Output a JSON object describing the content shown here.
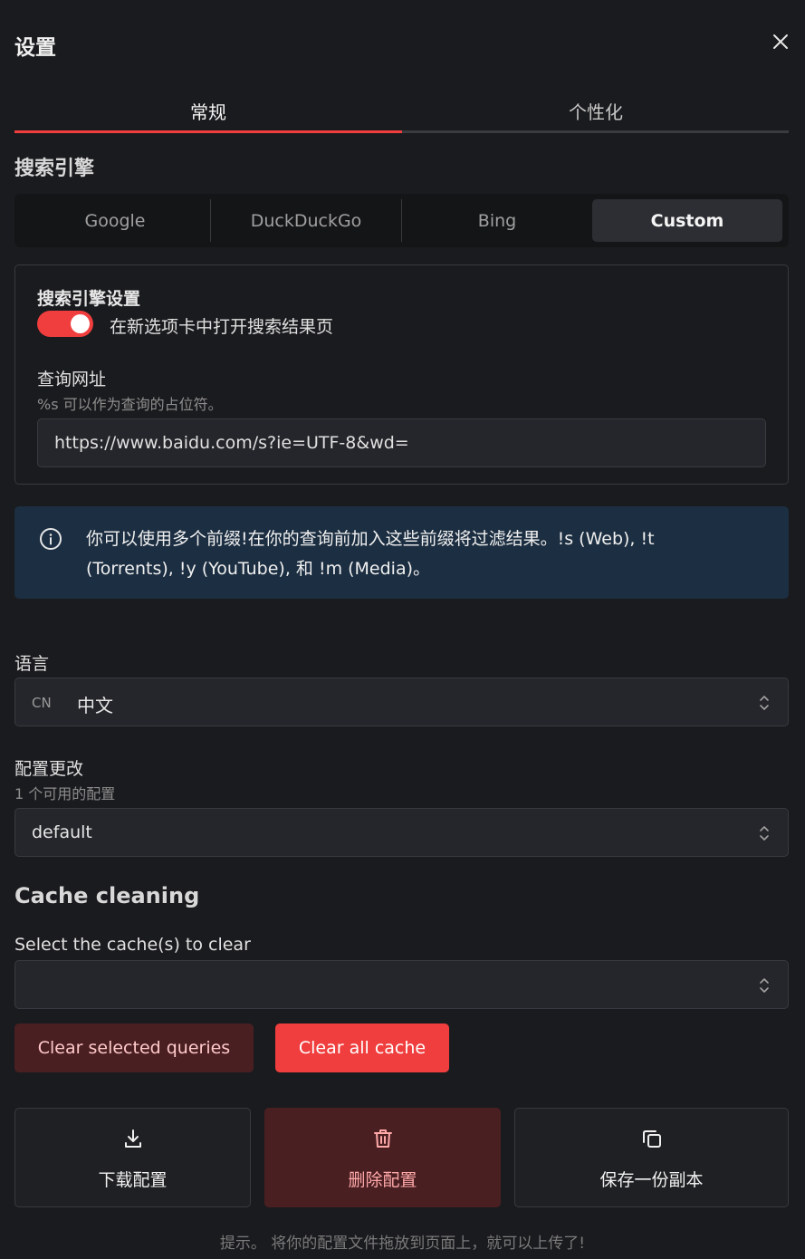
{
  "header": {
    "title": "设置",
    "close_icon": "close-icon"
  },
  "tabs": [
    {
      "label": "常规",
      "active": true
    },
    {
      "label": "个性化",
      "active": false
    }
  ],
  "search_engine": {
    "section_title": "搜索引擎",
    "options": [
      "Google",
      "DuckDuckGo",
      "Bing",
      "Custom"
    ],
    "selected": "Custom"
  },
  "engine_settings": {
    "title": "搜索引擎设置",
    "toggle_label": "在新选项卡中打开搜索结果页",
    "toggle_on": true,
    "query_url_label": "查询网址",
    "query_url_desc": "%s 可以作为查询的占位符。",
    "query_url_value": "https://www.baidu.com/s?ie=UTF-8&wd="
  },
  "info_alert": {
    "icon": "info-icon",
    "text": "你可以使用多个前缀!在你的查询前加入这些前缀将过滤结果。!s (Web), !t (Torrents), !y (YouTube), 和 !m (Media)。"
  },
  "language": {
    "label": "语言",
    "code": "CN",
    "value": "中文"
  },
  "config": {
    "label": "配置更改",
    "desc": "1 个可用的配置",
    "value": "default"
  },
  "cache": {
    "section_title": "Cache cleaning",
    "select_label": "Select the cache(s) to clear",
    "select_value": "",
    "clear_selected_label": "Clear selected queries",
    "clear_all_label": "Clear all cache"
  },
  "actions": [
    {
      "label": "下载配置",
      "icon": "download-icon"
    },
    {
      "label": "删除配置",
      "icon": "trash-icon"
    },
    {
      "label": "保存一份副本",
      "icon": "copy-icon"
    }
  ],
  "hint": "提示。 将你的配置文件拖放到页面上，就可以上传了!",
  "colors": {
    "accent": "#f03e3e",
    "background": "#1a1b1e",
    "alert_bg": "#1c2e41",
    "danger_bg": "#4a1f22"
  }
}
